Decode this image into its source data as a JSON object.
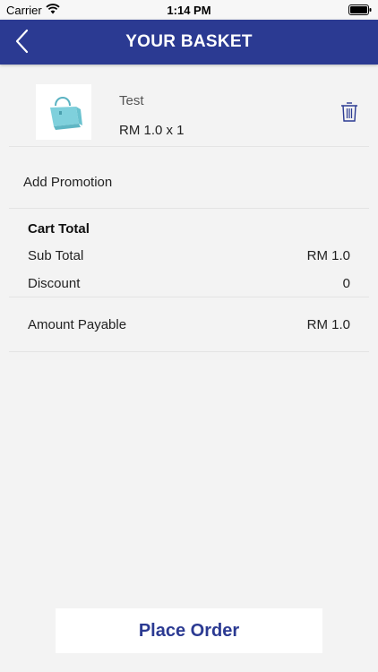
{
  "status": {
    "carrier": "Carrier",
    "time": "1:14 PM"
  },
  "header": {
    "title": "YOUR BASKET"
  },
  "cart_item": {
    "name": "Test",
    "price_qty": "RM 1.0 x 1"
  },
  "promotion": {
    "label": "Add Promotion"
  },
  "totals": {
    "title": "Cart Total",
    "sub_total_label": "Sub Total",
    "sub_total_value": "RM 1.0",
    "discount_label": "Discount",
    "discount_value": "0",
    "payable_label": "Amount Payable",
    "payable_value": "RM 1.0"
  },
  "footer": {
    "place_order_label": "Place Order"
  },
  "colors": {
    "brand": "#2b3a92",
    "background": "#f3f3f3",
    "bag": "#7fd0dc"
  }
}
